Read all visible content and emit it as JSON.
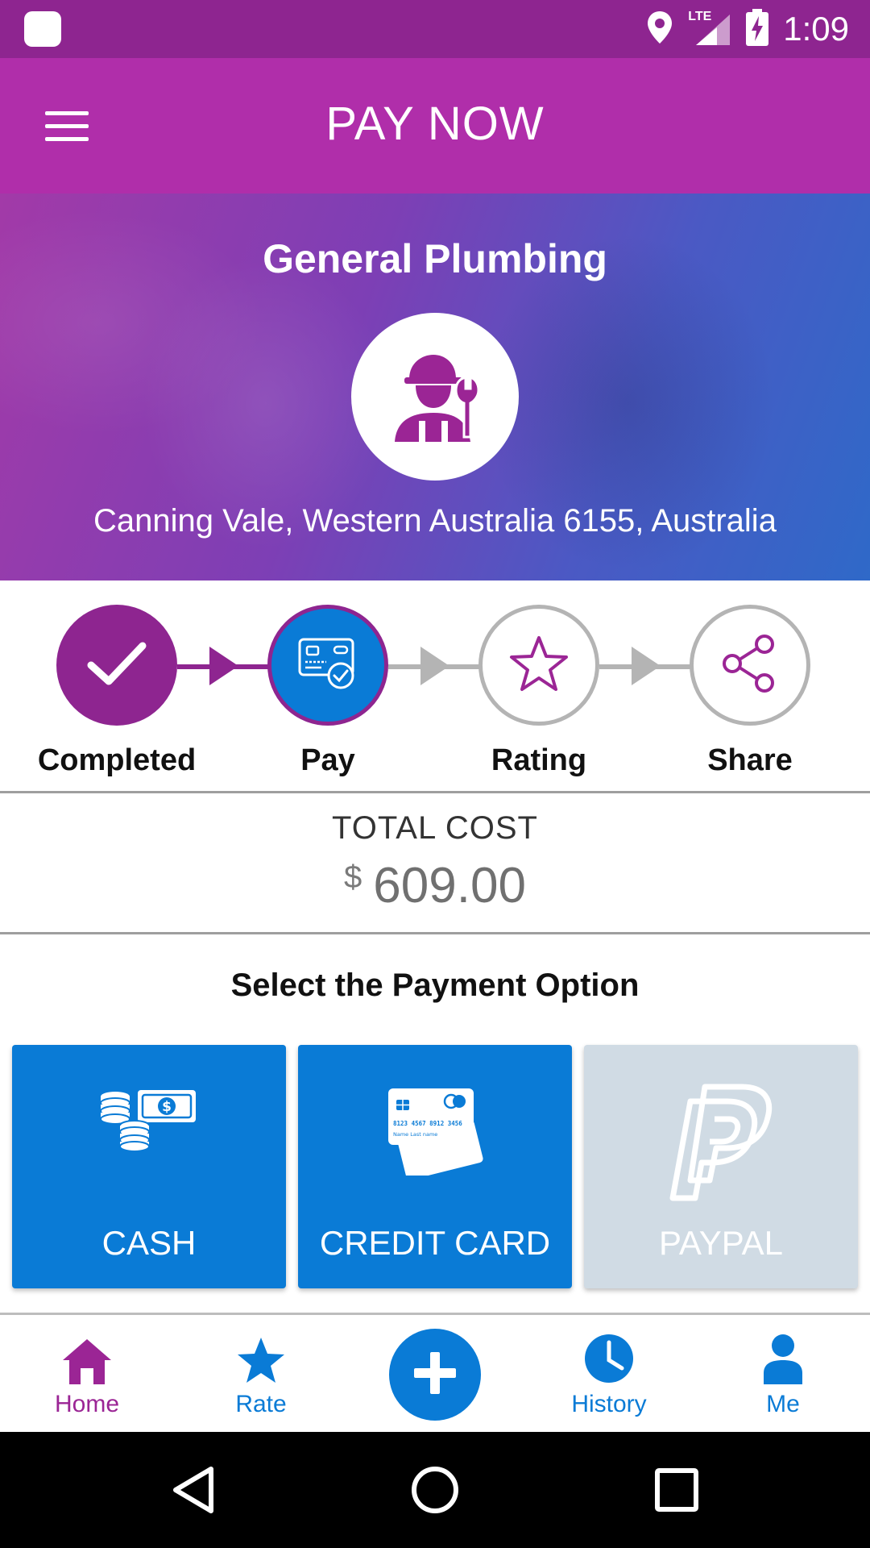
{
  "status_bar": {
    "time": "1:09",
    "network": "LTE"
  },
  "app_bar": {
    "title": "PAY NOW"
  },
  "hero": {
    "title": "General Plumbing",
    "address": "Canning Vale, Western Australia 6155, Australia"
  },
  "steps": [
    {
      "label": "Completed",
      "icon": "check-icon",
      "state": "done"
    },
    {
      "label": "Pay",
      "icon": "card-check-icon",
      "state": "current"
    },
    {
      "label": "Rating",
      "icon": "star-outline-icon",
      "state": "pending"
    },
    {
      "label": "Share",
      "icon": "share-icon",
      "state": "pending"
    }
  ],
  "total": {
    "label": "TOTAL COST",
    "currency": "$",
    "amount": "609.00"
  },
  "payment": {
    "heading": "Select the Payment Option",
    "options": [
      {
        "label": "CASH",
        "icon": "cash-icon",
        "enabled": true
      },
      {
        "label": "CREDIT CARD",
        "icon": "credit-card-icon",
        "enabled": true
      },
      {
        "label": "PAYPAL",
        "icon": "paypal-icon",
        "enabled": false
      }
    ],
    "card_text": {
      "number": "8123 4567 8912 3456",
      "name": "Name  Last name"
    }
  },
  "bottom_nav": [
    {
      "label": "Home",
      "icon": "home-icon",
      "active": true
    },
    {
      "label": "Rate",
      "icon": "star-icon",
      "active": false
    },
    {
      "label": "",
      "icon": "plus-icon",
      "active": false
    },
    {
      "label": "History",
      "icon": "clock-icon",
      "active": false
    },
    {
      "label": "Me",
      "icon": "person-icon",
      "active": false
    }
  ],
  "colors": {
    "primary_purple": "#b02eaa",
    "status_purple": "#8e2590",
    "step_purple": "#8e2590",
    "blue": "#0a7bd6",
    "disabled": "#d0dbe4",
    "gray_line": "#b4b4b4"
  }
}
